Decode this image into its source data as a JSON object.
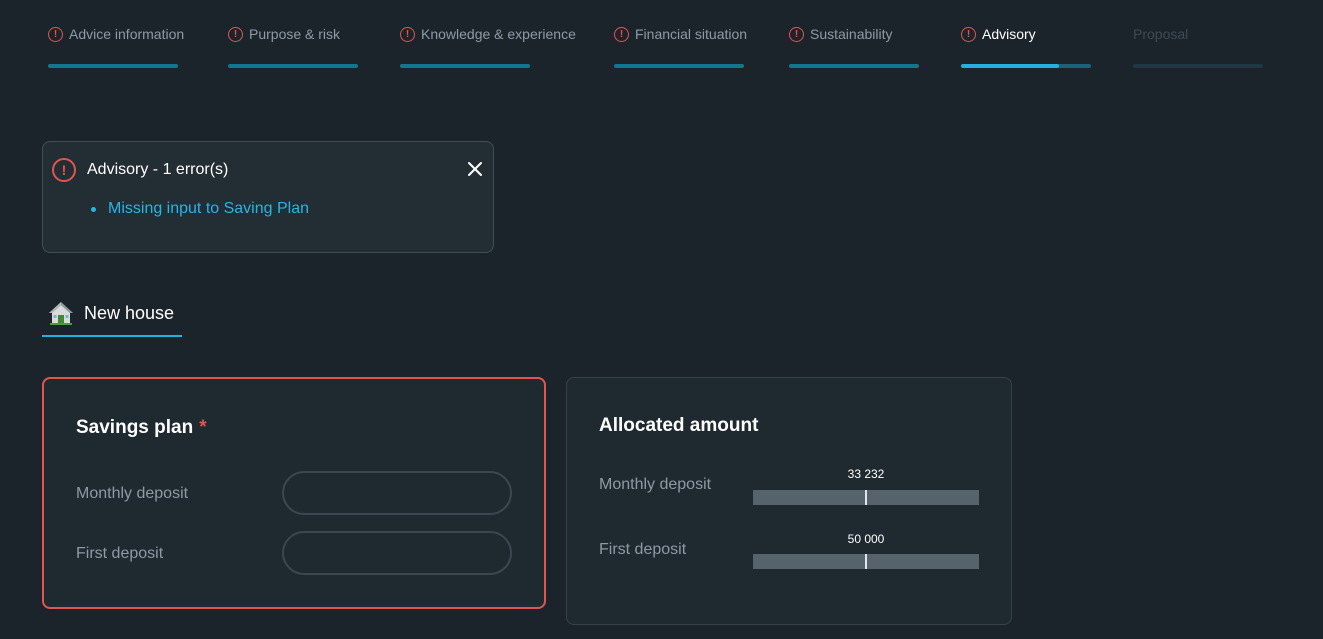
{
  "stepper": {
    "steps": [
      {
        "label": "Advice information",
        "state": "error"
      },
      {
        "label": "Purpose & risk",
        "state": "error"
      },
      {
        "label": "Knowledge & experience",
        "state": "error"
      },
      {
        "label": "Financial situation",
        "state": "error"
      },
      {
        "label": "Sustainability",
        "state": "error"
      },
      {
        "label": "Advisory",
        "state": "active-error",
        "progress": 0.75
      },
      {
        "label": "Proposal",
        "state": "disabled"
      }
    ],
    "error_icon_glyph": "!"
  },
  "error_box": {
    "title": "Advisory - 1 error(s)",
    "icon": "alert-circle-icon",
    "close_icon": "close-icon",
    "errors": [
      "Missing input to Saving Plan"
    ]
  },
  "goal_tab": {
    "label": "New house",
    "icon": "house-icon"
  },
  "savings_plan": {
    "title": "Savings plan",
    "required_mark": "*",
    "monthly_deposit": {
      "label": "Monthly deposit",
      "value": "",
      "placeholder": ""
    },
    "first_deposit": {
      "label": "First deposit",
      "value": "",
      "placeholder": ""
    }
  },
  "allocated_amount": {
    "title": "Allocated amount",
    "monthly_deposit": {
      "label": "Monthly deposit",
      "value": "33 232",
      "fraction": 0.5
    },
    "first_deposit": {
      "label": "First deposit",
      "value": "50 000",
      "fraction": 0.5
    }
  },
  "colors": {
    "background": "#1c242b",
    "accent": "#24b1e2",
    "error": "#e2554f",
    "step_bar": "#12768e"
  }
}
